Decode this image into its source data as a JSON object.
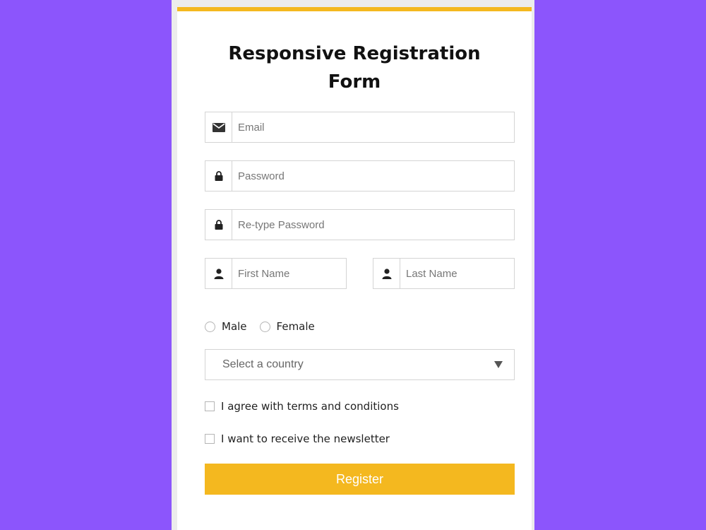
{
  "form": {
    "title_line1": "Responsive Registration",
    "title_line2": "Form",
    "email_placeholder": "Email",
    "password_placeholder": "Password",
    "retype_password_placeholder": "Re-type Password",
    "first_name_placeholder": "First Name",
    "last_name_placeholder": "Last Name",
    "gender_options": [
      "Male",
      "Female"
    ],
    "country_select_placeholder": "Select a country",
    "terms_label": "I agree with terms and conditions",
    "newsletter_label": "I want to receive the newsletter",
    "register_label": "Register"
  },
  "colors": {
    "background": "#8c55fc",
    "accent": "#f4b81f",
    "card": "#ffffff"
  },
  "icons": {
    "email": "envelope-icon",
    "password": "lock-icon",
    "name": "user-icon",
    "select": "caret-down-icon"
  }
}
